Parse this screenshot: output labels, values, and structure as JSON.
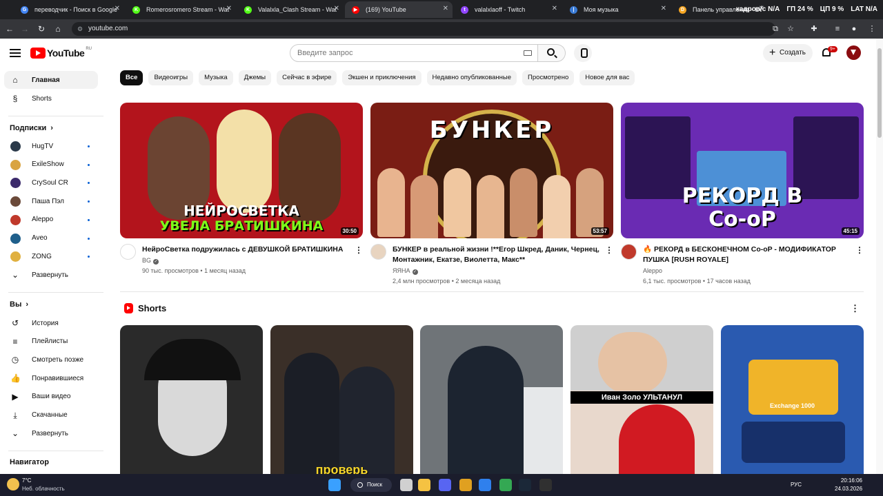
{
  "browser": {
    "tabs": [
      {
        "title": "переводчик - Поиск в Google",
        "favicon_color": "#4285f4",
        "favicon": "G"
      },
      {
        "title": "Romerosromero Stream - Watch",
        "favicon_color": "#53fc18",
        "favicon": "K"
      },
      {
        "title": "Valalxla_Clash Stream - Watch L",
        "favicon_color": "#53fc18",
        "favicon": "K"
      },
      {
        "title": "(169) YouTube",
        "favicon_color": "#ff0000",
        "favicon": "▶"
      },
      {
        "title": "valalxlaoff - Twitch",
        "favicon_color": "#9146ff",
        "favicon": "t"
      },
      {
        "title": "Моя музыка",
        "favicon_color": "#3a7bd5",
        "favicon": "|"
      },
      {
        "title": "Панель управления - Donat",
        "favicon_color": "#f5a623",
        "favicon": "D"
      }
    ],
    "url": "youtube.com",
    "overlay": [
      "кадров/с N/A",
      "ГП 24 %",
      "ЦП 9 %",
      "LAT N/A"
    ]
  },
  "header": {
    "logo_text": "YouTube",
    "country_code": "RU",
    "search_placeholder": "Введите запрос",
    "create_label": "Создать",
    "notifications_badge": "9+"
  },
  "sidebar": {
    "main": [
      {
        "label": "Главная",
        "icon": "home-icon",
        "glyph": "⌂",
        "active": true
      },
      {
        "label": "Shorts",
        "icon": "shorts-icon",
        "glyph": "§",
        "active": false
      }
    ],
    "subscriptions_heading": "Подписки",
    "subscriptions": [
      {
        "label": "HugTV",
        "color": "#2b3a4a"
      },
      {
        "label": "ExileShow",
        "color": "#d9a441"
      },
      {
        "label": "CrySoul CR",
        "color": "#3b2a6b"
      },
      {
        "label": "Паша Пэл",
        "color": "#6b4a3a"
      },
      {
        "label": "Aleppo",
        "color": "#c0392b"
      },
      {
        "label": "Aveo",
        "color": "#1f5f8b"
      },
      {
        "label": "ZONG",
        "color": "#e0b040"
      }
    ],
    "expand_subs": "Развернуть",
    "you_heading": "Вы",
    "you_items": [
      {
        "label": "История",
        "icon": "history-icon",
        "glyph": "↺"
      },
      {
        "label": "Плейлисты",
        "icon": "playlists-icon",
        "glyph": "≡"
      },
      {
        "label": "Смотреть позже",
        "icon": "watch-later-icon",
        "glyph": "◷"
      },
      {
        "label": "Понравившиеся",
        "icon": "liked-icon",
        "glyph": "👍"
      },
      {
        "label": "Ваши видео",
        "icon": "your-videos-icon",
        "glyph": "▶"
      },
      {
        "label": "Скачанные",
        "icon": "downloads-icon",
        "glyph": "⤓"
      }
    ],
    "expand_you": "Развернуть",
    "navigator_heading": "Навигатор"
  },
  "chips": [
    "Все",
    "Видеоигры",
    "Музыка",
    "Джемы",
    "Сейчас в эфире",
    "Экшен и приключения",
    "Недавно опубликованные",
    "Просмотрено",
    "Новое для вас"
  ],
  "videos": [
    {
      "title": "НейроСветка подружилась с ДЕВУШКОЙ БРАТИШКИНА",
      "channel": "BG",
      "verified": true,
      "views": "90 тыс. просмотров",
      "age": "1 месяц назад",
      "duration": "30:50",
      "thumb_line1": "НЕЙРОСВЕТКА",
      "thumb_line2": "УВЕЛА БРАТИШКИНА",
      "thumb_bg": "#b3141c",
      "avatar_color": "#ffffff"
    },
    {
      "title": "БУНКЕР в реальной жизни !**Егор Шкред, Даник, Чернец, Монтажник, Екатзе, Виолетта, Макс**",
      "channel": "ЯЯНА",
      "verified": true,
      "views": "2,4 млн просмотров",
      "age": "2 месяца назад",
      "duration": "53:57",
      "thumb_line1": "БУНКЕР",
      "thumb_line2": "",
      "thumb_bg": "#7a1d14",
      "avatar_color": "#e8d4c0"
    },
    {
      "title": "🔥 РЕКОРД в БЕСКОНЕЧНОМ Co-oP - МОДИФИКАТОР ПУШКА [RUSH ROYALE]",
      "channel": "Aleppo",
      "verified": false,
      "views": "6,1 тыс. просмотров",
      "age": "17 часов назад",
      "duration": "45:15",
      "thumb_line1": "РЕКОРД В",
      "thumb_line2": "Co-oP",
      "thumb_bg": "#6a2bb3",
      "avatar_color": "#c0392b"
    }
  ],
  "shorts": {
    "heading": "Shorts",
    "items": [
      {
        "caption": "",
        "bg": "#2a2a2a"
      },
      {
        "caption": "проверь",
        "bg": "#3a2f28"
      },
      {
        "caption": "",
        "bg": "#6f7478"
      },
      {
        "caption": "Иван Золо УЛЬТАНУЛ",
        "bg": "#cfcfcf"
      },
      {
        "caption": "Exchange 1000",
        "bg": "#2a5ab0"
      }
    ]
  },
  "taskbar": {
    "temperature": "7°C",
    "weather": "Неб. облачность",
    "search_label": "Поиск",
    "language": "РУС",
    "time": "20:16:06",
    "date": "24.03.2026",
    "apps": [
      {
        "name": "windows-start-icon",
        "color": "#3aa0ff"
      },
      {
        "name": "task-view-icon",
        "color": "#d0d0d0"
      },
      {
        "name": "file-explorer-icon",
        "color": "#f5c242"
      },
      {
        "name": "discord-icon",
        "color": "#5865f2"
      },
      {
        "name": "app-icon",
        "color": "#e0a020"
      },
      {
        "name": "mail-icon",
        "color": "#2f80ed"
      },
      {
        "name": "chrome-icon",
        "color": "#34a853"
      },
      {
        "name": "steam-icon",
        "color": "#1b2838"
      },
      {
        "name": "obs-icon",
        "color": "#303030"
      }
    ]
  }
}
